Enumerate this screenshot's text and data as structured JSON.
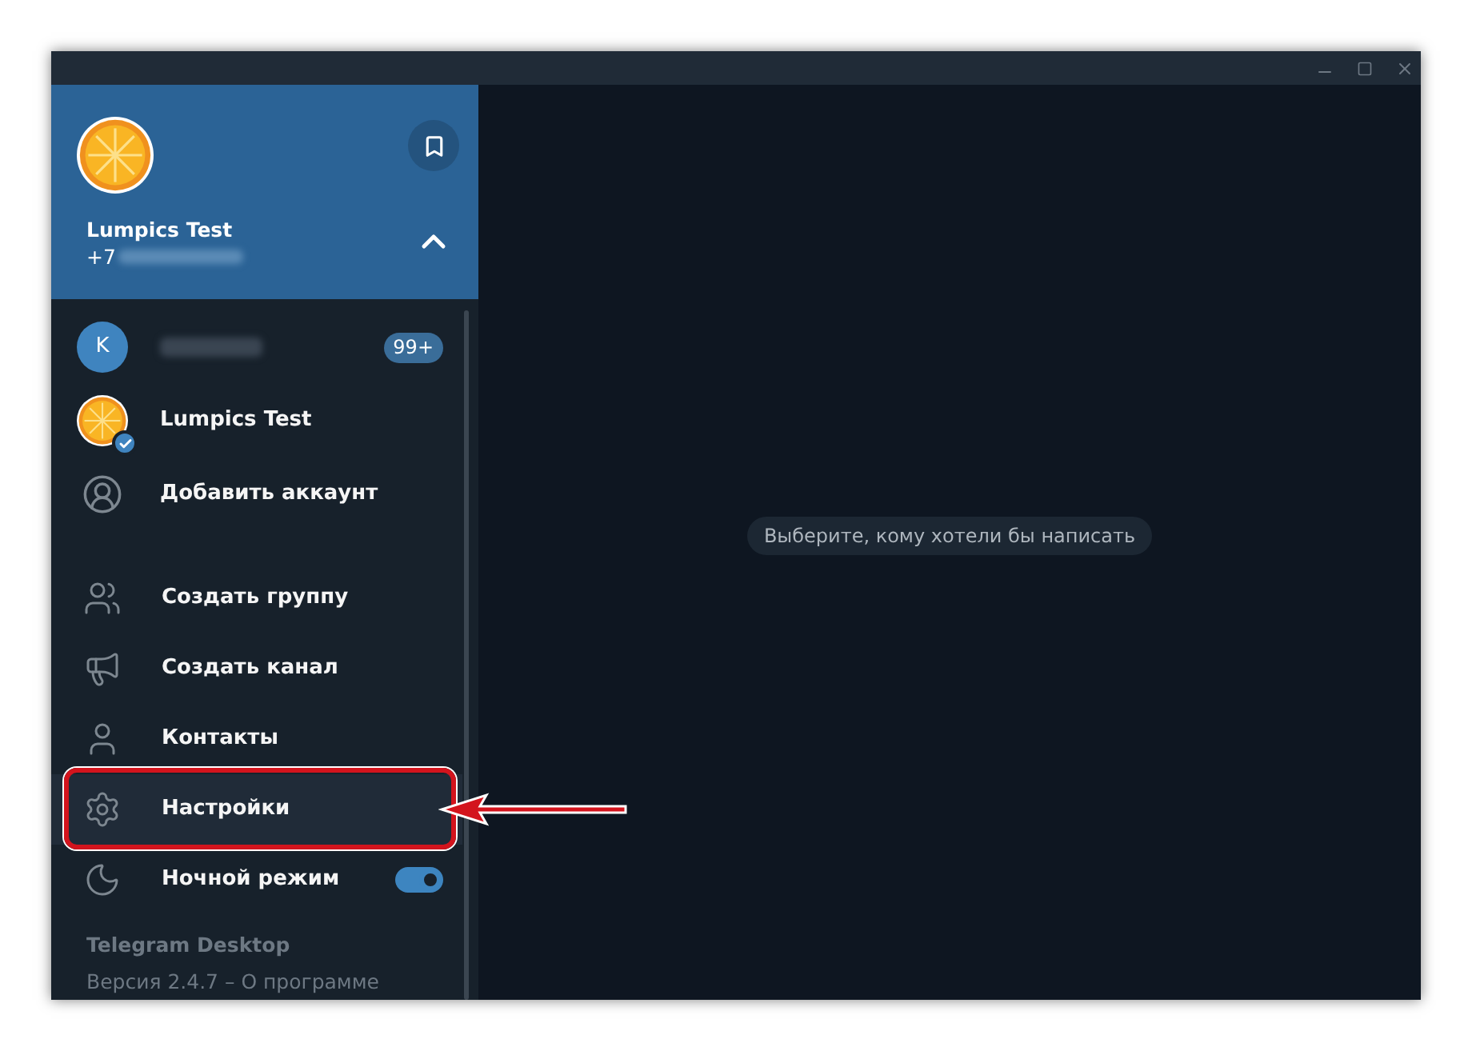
{
  "profile": {
    "name": "Lumpics Test",
    "phone": "+7"
  },
  "accounts": [
    {
      "kind": "letter",
      "letter": "K",
      "badge": "99+",
      "selected": false
    },
    {
      "kind": "avatar",
      "name": "Lumpics Test",
      "selected": true
    },
    {
      "kind": "add",
      "name": "Добавить аккаунт",
      "selected": false
    }
  ],
  "menu": [
    {
      "kind": "group",
      "label": "Создать группу",
      "selected": false
    },
    {
      "kind": "channel",
      "label": "Создать канал",
      "selected": false
    },
    {
      "kind": "contacts",
      "label": "Контакты",
      "selected": false
    },
    {
      "kind": "settings",
      "label": "Настройки",
      "selected": true
    },
    {
      "kind": "night",
      "label": "Ночной режим",
      "selected": false,
      "on": true
    }
  ],
  "footer": {
    "app": "Telegram Desktop",
    "version": "Версия 2.4.7 – О программе"
  },
  "placeholder": "Выберите, кому хотели бы написать"
}
